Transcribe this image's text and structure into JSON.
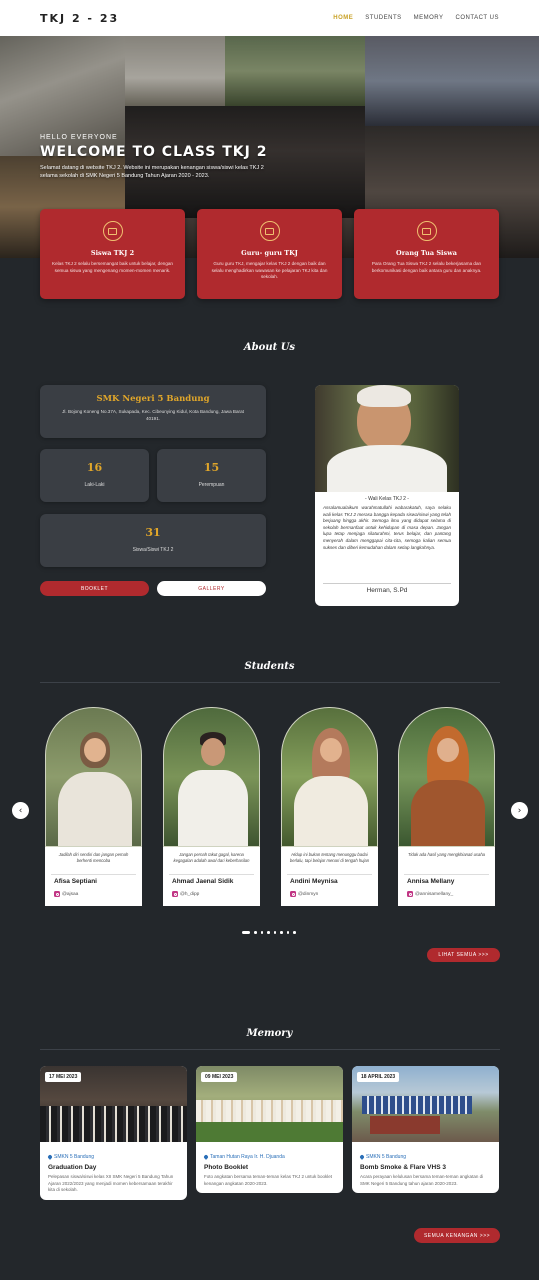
{
  "nav": {
    "brand": "TKJ 2 - 23",
    "items": [
      "HOME",
      "STUDENTS",
      "MEMORY",
      "CONTACT US"
    ]
  },
  "hero": {
    "kicker": "HELLO EVERYONE",
    "title": "WELCOME TO CLASS TKJ 2",
    "description": "Selamat datang di website TKJ 2. Website ini merupakan kenangan siswa/siswi kelas TKJ 2 selama sekolah di SMK Negeri 5 Bandung Tahun Ajaran 2020 - 2023."
  },
  "features": [
    {
      "title": "Siswa TKJ 2",
      "text": "Kelas TKJ 2 selalu bersemangat baik untuk belajar, dengan semua siswa yang mengenang momen-momen menarik.",
      "icon": "student-icon"
    },
    {
      "title": "Guru- guru TKJ",
      "text": "Guru guru TKJ, mengajar kelas TKJ 2 dengan baik dan selalu menghadirkan wawasan ke pelajaran TKJ kita dan sekolah.",
      "icon": "teacher-icon"
    },
    {
      "title": "Orang Tua Siswa",
      "text": "Para Orang Tua Siswa TKJ 2 selalu bekerjasama dan berkomunikasi dengan baik antara guru dan anaknya.",
      "icon": "parents-icon"
    }
  ],
  "about": {
    "heading": "About Us",
    "school_name": "SMK Negeri 5 Bandung",
    "school_address": "Jl. Bojong Koneng No.37A, Sukapada, Kec. Cibeunying Kidul, Kota Bandung, Jawa Barat 40191.",
    "stats": [
      {
        "value": "16",
        "label": "Laki-Laki"
      },
      {
        "value": "15",
        "label": "Perempuan"
      },
      {
        "value": "31",
        "label": "Siswa/Siswi TKJ 2"
      }
    ],
    "buttons": {
      "booklet": "BOOKLET",
      "gallery": "GALLERY"
    },
    "teacher": {
      "role": "- Wali Kelas TKJ 2 -",
      "quote": "Assalamualaikum warahmatullahi wabarakatuh, saya selaku wali kelas TKJ 2 merasa bangga kepada siswa/siswi yang telah berjuang hingga akhir. Semoga ilmu yang didapat selama di sekolah bermanfaat untuk kehidupan di masa depan. Jangan lupa tetap menjaga silaturahmi, terus belajar, dan pantang menyerah dalam menggapai cita-cita, semoga kalian semua sukses dan diberi kemudahan dalam setiap langkahnya.",
      "name": "Herman, S.Pd"
    }
  },
  "students": {
    "heading": "Students",
    "list": [
      {
        "name": "Afisa Septiani",
        "ig": "@ajsaa",
        "quote": "Jadilah diri sendiri dan jangan pernah berhenti mencoba"
      },
      {
        "name": "Ahmad Jaenal Sidik",
        "ig": "@h_dipp",
        "quote": "Jangan pernah takut gagal, karena kegagalan adalah awal dari keberhasilan"
      },
      {
        "name": "Andini Meynisa",
        "ig": "@dinmyn",
        "quote": "Hidup ini bukan tentang menunggu badai berlalu, tapi belajar menari di tengah hujan"
      },
      {
        "name": "Annisa Mellany",
        "ig": "@annisamellany_",
        "quote": "Tidak ada hasil yang mengkhianati usaha"
      }
    ],
    "prev_arrow": "‹",
    "next_arrow": "›",
    "see_all": "LIHAT SEMUA >>>"
  },
  "memory": {
    "heading": "Memory",
    "list": [
      {
        "date": "17 MEI 2023",
        "location": "SMKN 5 Bandung",
        "title": "Graduation Day",
        "text": "Pelepasan siswa/siswi kelas XII SMK Negeri 5 Bandung Tahun Ajaran 2022/2023 yang menjadi momen kebersamaan terakhir kita di sekolah."
      },
      {
        "date": "09 MEI 2023",
        "location": "Taman Hutan Raya Ir. H. Djuanda",
        "title": "Photo Booklet",
        "text": "Foto angkatan bersama teman-teman kelas TKJ 2 untuk booklet kenangan angkatan 2020-2023."
      },
      {
        "date": "18 APRIL 2023",
        "location": "SMKN 5 Bandung",
        "title": "Bomb Smoke & Flare VHS 3",
        "text": "Acara perayaan kelulusan bersama teman-teman angkatan di SMK Negeri 5 Bandung tahun ajaran 2020-2023."
      }
    ],
    "see_all": "SEMUA KENANGAN >>>"
  }
}
